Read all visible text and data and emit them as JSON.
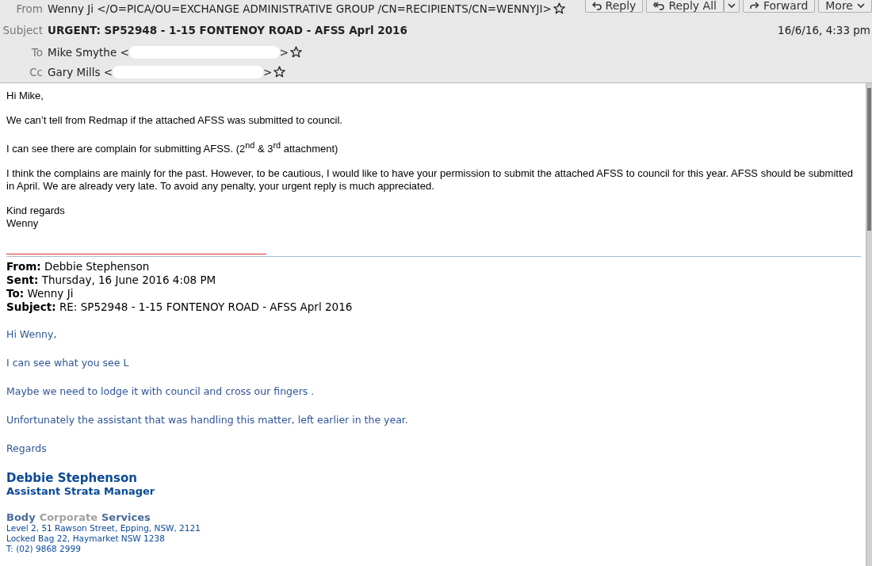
{
  "header": {
    "buttons": [
      {
        "label": "Reply"
      },
      {
        "label": "Reply All"
      },
      {
        "label": "Forward"
      },
      {
        "label": "More"
      }
    ],
    "fields": [
      {
        "label": "From",
        "value": "Wenny Ji </O=PICA/OU=EXCHANGE ADMINISTRATIVE GROUP /CN=RECIPIENTS/CN=WENNYJI>",
        "kind": "address"
      },
      {
        "label": "Subject",
        "value": "URGENT: SP52948 - 1-15 FONTENOY ROAD - AFSS Aprl 2016",
        "kind": "subject",
        "date": "16/6/16, 4:33 pm"
      },
      {
        "label": "To",
        "value": "Mike Smythe <",
        "end": ">",
        "kind": "address"
      },
      {
        "label": "Cc",
        "value": "Gary Mills <",
        "end": ">",
        "kind": "address"
      }
    ]
  },
  "message": {
    "paragraphs": [
      [
        "Hi Mike,"
      ],
      [
        "We can’t tell from Redmap if the attached AFSS was submitted to council."
      ],
      [
        "I can see there are complain for submitting AFSS. (2$^{nd}$ & 3$^{rd}$ attachment)"
      ],
      [
        "I think the complains are mainly for the past. However, to be cautious, I would like to have your permission to submit the attached AFSS to council for this year. AFSS should be submitted in April. We are already very late. To avoid any penalty, your urgent reply is much appreciated."
      ],
      [
        "Kind regards",
        "Wenny"
      ]
    ]
  },
  "quoted": {
    "headers": [
      {
        "label": "From:",
        "value": "Debbie Stephenson"
      },
      {
        "label": "Sent:",
        "value": "Thursday, 16 June 2016 4:08 PM"
      },
      {
        "label": "To:",
        "value": "Wenny Ji"
      },
      {
        "label": "Subject:",
        "value": "RE: SP52948 - 1-15 FONTENOY ROAD - AFSS Aprl 2016"
      }
    ],
    "paragraphs": [
      "Hi Wenny,",
      "I can see what you see L",
      "Maybe we need to lodge it with council and cross our fingers .",
      "Unfortunately the assistant that was handling this matter, left earlier in the year.",
      "Regards"
    ],
    "signature": {
      "name": "Debbie Stephenson",
      "title": "Assistant Strata Manager",
      "company": [
        {
          "text": "Body",
          "color": "#4a6a9a"
        },
        {
          "text": "Corporate",
          "color": "#a0a0a0"
        },
        {
          "text": "Services",
          "color": "#4a6a9a"
        }
      ],
      "lines": [
        "Level 2, 51 Rawson Street, Epping, NSW, 2121",
        "Locked Bag 22, Haymarket NSW 1238",
        "T: (02) 9868 2999"
      ]
    }
  }
}
